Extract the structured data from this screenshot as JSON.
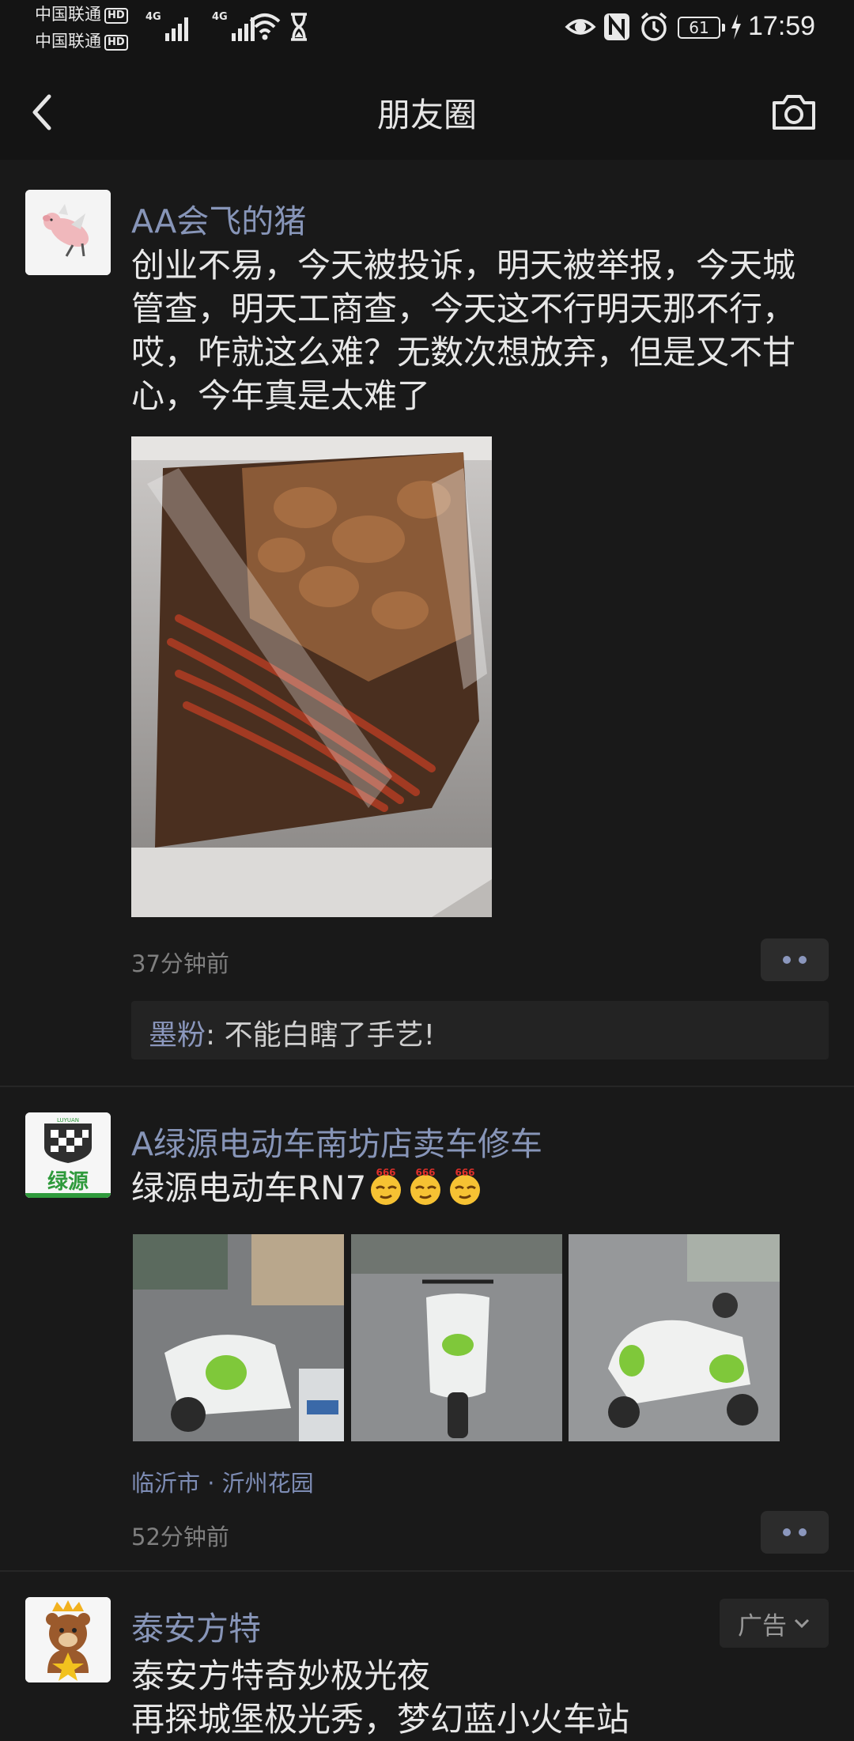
{
  "status_bar": {
    "carrier1": "中国联通",
    "carrier2": "中国联通",
    "hd": "HD",
    "net_label": "4G",
    "battery": "61",
    "time": "17:59"
  },
  "nav": {
    "title": "朋友圈"
  },
  "posts": [
    {
      "name": "AA会飞的猪",
      "text": "创业不易，今天被投诉，明天被举报，今天城管查，明天工商查，今天这不行明天那不行，哎，咋就这么难？无数次想放弃，但是又不甘心，今年真是太难了",
      "time": "37分钟前",
      "comment": {
        "author": "墨粉",
        "separator": ": ",
        "text": "不能白瞎了手艺!"
      }
    },
    {
      "name": "A绿源电动车南坊店卖车修车",
      "text": "绿源电动车RN7",
      "emoji_label": "666",
      "location": "临沂市 · 沂州花园",
      "time": "52分钟前",
      "logo_text": "绿源",
      "logo_small": "LUYUAN"
    },
    {
      "name": "泰安方特",
      "ad_label": "广告",
      "text_line1": "泰安方特奇妙极光夜",
      "text_line2": "再探城堡极光秀，梦幻蓝小火车站"
    }
  ],
  "colors": {
    "background": "#191919",
    "name_link": "#8795b8",
    "text": "#e7e7e7",
    "meta": "#7f7f7f"
  }
}
